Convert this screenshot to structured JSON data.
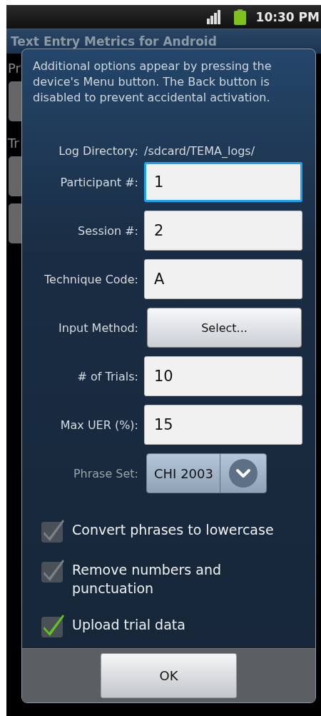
{
  "status_bar": {
    "time": "10:30 PM"
  },
  "app": {
    "title": "Text Entry Metrics for Android",
    "background_labels": [
      "Pr",
      "Tr"
    ]
  },
  "dialog": {
    "message": "Additional options appear by pressing the device's Menu button. The Back button is disabled to prevent accidental activation.",
    "log_directory": {
      "label": "Log Directory:",
      "value": "/sdcard/TEMA_logs/"
    },
    "rows": [
      {
        "kind": "field",
        "label": "Participant #:",
        "value": "1",
        "focused": true
      },
      {
        "kind": "field",
        "label": "Session #:",
        "value": "2",
        "focused": false
      },
      {
        "kind": "field",
        "label": "Technique Code:",
        "value": "A",
        "focused": false
      },
      {
        "kind": "button",
        "label": "Input Method:",
        "value": "Select..."
      },
      {
        "kind": "field",
        "label": "# of Trials:",
        "value": "10",
        "focused": false
      },
      {
        "kind": "field",
        "label": "Max UER (%):",
        "value": "15",
        "focused": false
      },
      {
        "kind": "spinner",
        "label": "Phrase Set:",
        "value": "CHI 2003"
      }
    ],
    "checkboxes": [
      {
        "label": "Convert phrases to lowercase",
        "checked": true,
        "disabled": true
      },
      {
        "label": "Remove numbers and punctuation",
        "checked": true,
        "disabled": true
      },
      {
        "label": "Upload trial data",
        "checked": true,
        "disabled": false
      }
    ],
    "ok_button": "OK"
  }
}
